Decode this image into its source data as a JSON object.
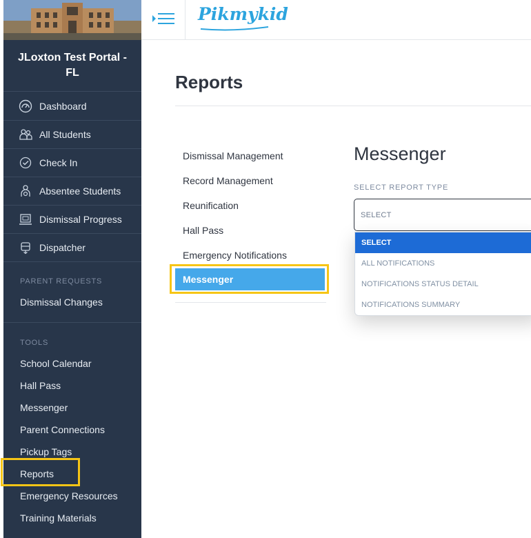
{
  "brand": {
    "name": "Pikmykid"
  },
  "sidebar": {
    "school_name": "JLoxton Test Portal - FL",
    "nav": [
      {
        "label": "Dashboard",
        "icon": "dashboard-icon"
      },
      {
        "label": "All Students",
        "icon": "students-icon"
      },
      {
        "label": "Check In",
        "icon": "check-in-icon"
      },
      {
        "label": "Absentee Students",
        "icon": "absentee-icon"
      },
      {
        "label": "Dismissal Progress",
        "icon": "dismissal-progress-icon"
      },
      {
        "label": "Dispatcher",
        "icon": "dispatcher-icon"
      }
    ],
    "parent_requests_heading": "PARENT REQUESTS",
    "parent_requests": [
      {
        "label": "Dismissal Changes"
      }
    ],
    "tools_heading": "TOOLS",
    "tools": [
      {
        "label": "School Calendar"
      },
      {
        "label": "Hall Pass"
      },
      {
        "label": "Messenger"
      },
      {
        "label": "Parent Connections"
      },
      {
        "label": "Pickup Tags"
      },
      {
        "label": "Reports"
      },
      {
        "label": "Emergency Resources"
      },
      {
        "label": "Training Materials"
      }
    ]
  },
  "main": {
    "title": "Reports",
    "categories": [
      {
        "label": "Dismissal Management"
      },
      {
        "label": "Record Management"
      },
      {
        "label": "Reunification"
      },
      {
        "label": "Hall Pass"
      },
      {
        "label": "Emergency Notifications"
      },
      {
        "label": "Messenger"
      }
    ],
    "active_category": "Messenger",
    "panel": {
      "title": "Messenger",
      "select_label": "SELECT REPORT TYPE",
      "select_value": "SELECT",
      "options": [
        {
          "label": "SELECT",
          "selected": true
        },
        {
          "label": "ALL NOTIFICATIONS",
          "selected": false
        },
        {
          "label": "NOTIFICATIONS STATUS DETAIL",
          "selected": false
        },
        {
          "label": "NOTIFICATIONS SUMMARY",
          "selected": false
        }
      ]
    }
  },
  "colors": {
    "sidebar_bg": "#28364a",
    "brand_blue": "#2ca4de",
    "active_item": "#45a8ea",
    "selected_option": "#1d6bd6",
    "highlight": "#f6c516"
  }
}
